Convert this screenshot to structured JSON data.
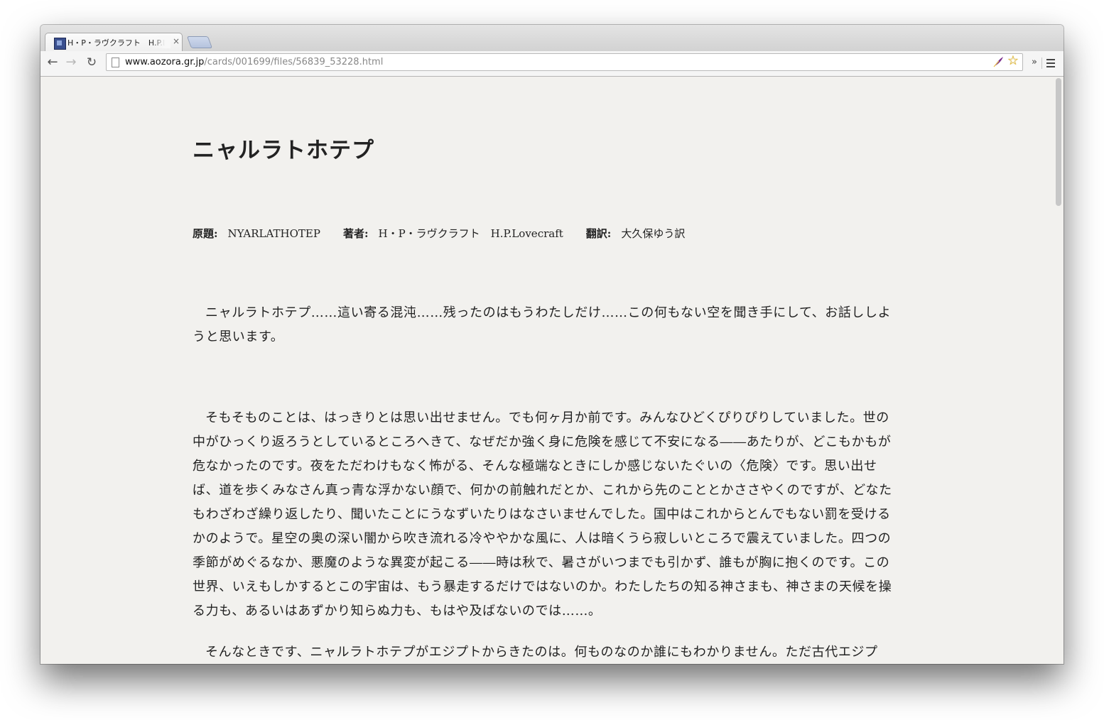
{
  "browser": {
    "tab": {
      "title": "H・P・ラヴクラフト　H.P.Lovecraft",
      "close_label": "×"
    },
    "nav": {
      "back_label": "←",
      "forward_label": "→",
      "reload_label": "↻"
    },
    "address_bar": {
      "host": "www.aozora.gr.jp",
      "path": "/cards/001699/files/56839_53228.html"
    },
    "bookmark_star": "☆",
    "extensions_overflow": "»",
    "icons": [
      "page-icon",
      "feather-extension-icon",
      "bookmark-star-icon",
      "menu-icon"
    ]
  },
  "page": {
    "title": "ニャルラトホテプ",
    "meta": {
      "original_title_label": "原題:",
      "original_title": "NYARLATHOTEP",
      "author_label": "著者:",
      "author": "H・P・ラヴクラフト　H.P.Lovecraft",
      "translator_label": "翻訳:",
      "translator": "大久保ゆう訳"
    },
    "paragraphs": [
      "ニャルラトホテプ……這い寄る混沌……残ったのはもうわたしだけ……この何もない空を聞き手にして、お話ししようと思います。",
      "そもそものことは、はっきりとは思い出せません。でも何ヶ月か前です。みんなひどくぴりぴりしていました。世の中がひっくり返ろうとしているところへきて、なぜだか強く身に危険を感じて不安になる――あたりが、どこもかもが危なかったのです。夜をただわけもなく怖がる、そんな極端なときにしか感じないたぐいの〈危険〉です。思い出せば、道を歩くみなさん真っ青な浮かない顔で、何かの前触れだとか、これから先のこととかささやくのですが、どなたもわざわざ繰り返したり、聞いたことにうなずいたりはなさいませんでした。国中はこれからとんでもない罰を受けるかのようで。星空の奥の深い闇から吹き流れる冷ややかな風に、人は暗くうら寂しいところで震えていました。四つの季節がめぐるなか、悪魔のような異変が起こる――時は秋で、暑さがいつまでも引かず、誰もが胸に抱くのです。この世界、いえもしかするとこの宇宙は、もう暴走するだけではないのか。わたしたちの知る神さまも、神さまの天候を操る力も、あるいはあずかり知らぬ力も、もはや及ばないのでは……。",
      "そんなときです、ニャルラトホテプがエジプトからきたのは。何ものなのか誰にもわかりません。ただ古代エジプ"
    ]
  }
}
